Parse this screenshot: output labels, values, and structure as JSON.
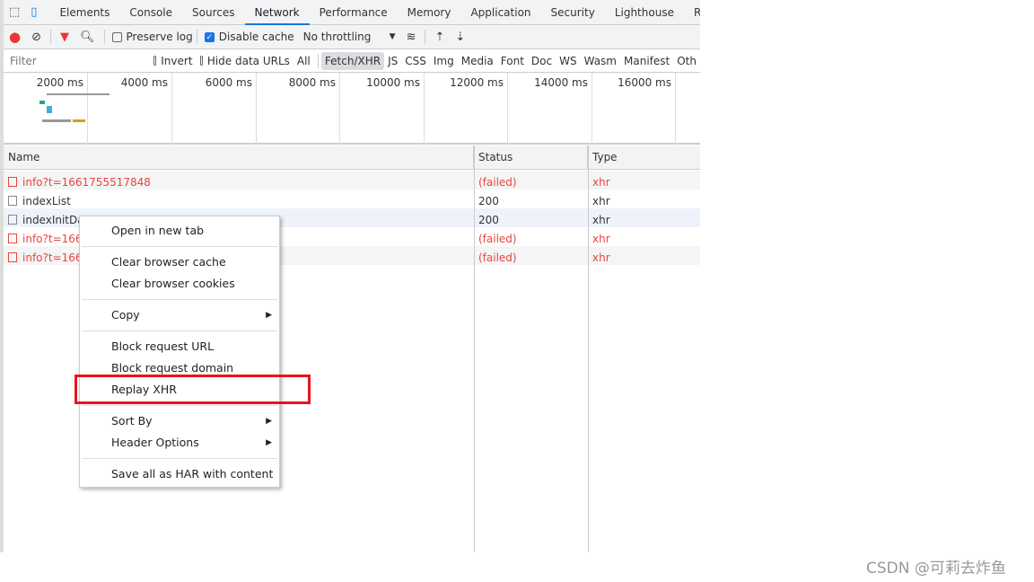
{
  "tabs": [
    "Elements",
    "Console",
    "Sources",
    "Network",
    "Performance",
    "Memory",
    "Application",
    "Security",
    "Lighthouse",
    "Reco"
  ],
  "toolbar": {
    "preserve_log": "Preserve log",
    "disable_cache": "Disable cache",
    "throttling": "No throttling"
  },
  "filter": {
    "placeholder": "Filter",
    "invert": "Invert",
    "hide_data_urls": "Hide data URLs",
    "types": [
      "All",
      "Fetch/XHR",
      "JS",
      "CSS",
      "Img",
      "Media",
      "Font",
      "Doc",
      "WS",
      "Wasm",
      "Manifest",
      "Oth"
    ],
    "selected": "Fetch/XHR"
  },
  "timeline": [
    "2000 ms",
    "4000 ms",
    "6000 ms",
    "8000 ms",
    "10000 ms",
    "12000 ms",
    "14000 ms",
    "16000 ms"
  ],
  "columns": [
    "Name",
    "Status",
    "Type"
  ],
  "rows": [
    {
      "name": "info?t=1661755517848",
      "status": "(failed)",
      "type": "xhr",
      "failed": true
    },
    {
      "name": "indexList",
      "status": "200",
      "type": "xhr",
      "failed": false
    },
    {
      "name": "indexInitDa",
      "status": "200",
      "type": "xhr",
      "failed": false
    },
    {
      "name": "info?t=166",
      "status": "(failed)",
      "type": "xhr",
      "failed": true
    },
    {
      "name": "info?t=166",
      "status": "(failed)",
      "type": "xhr",
      "failed": true
    }
  ],
  "menu": {
    "open_new_tab": "Open in new tab",
    "clear_cache": "Clear browser cache",
    "clear_cookies": "Clear browser cookies",
    "copy": "Copy",
    "block_url": "Block request URL",
    "block_domain": "Block request domain",
    "replay": "Replay XHR",
    "sort_by": "Sort By",
    "header_options": "Header Options",
    "save_har": "Save all as HAR with content"
  },
  "colors": {
    "accent": "#1a73e8",
    "error": "#e8453c",
    "highlight": "#e8141f"
  },
  "watermark": "CSDN @可莉去炸鱼"
}
